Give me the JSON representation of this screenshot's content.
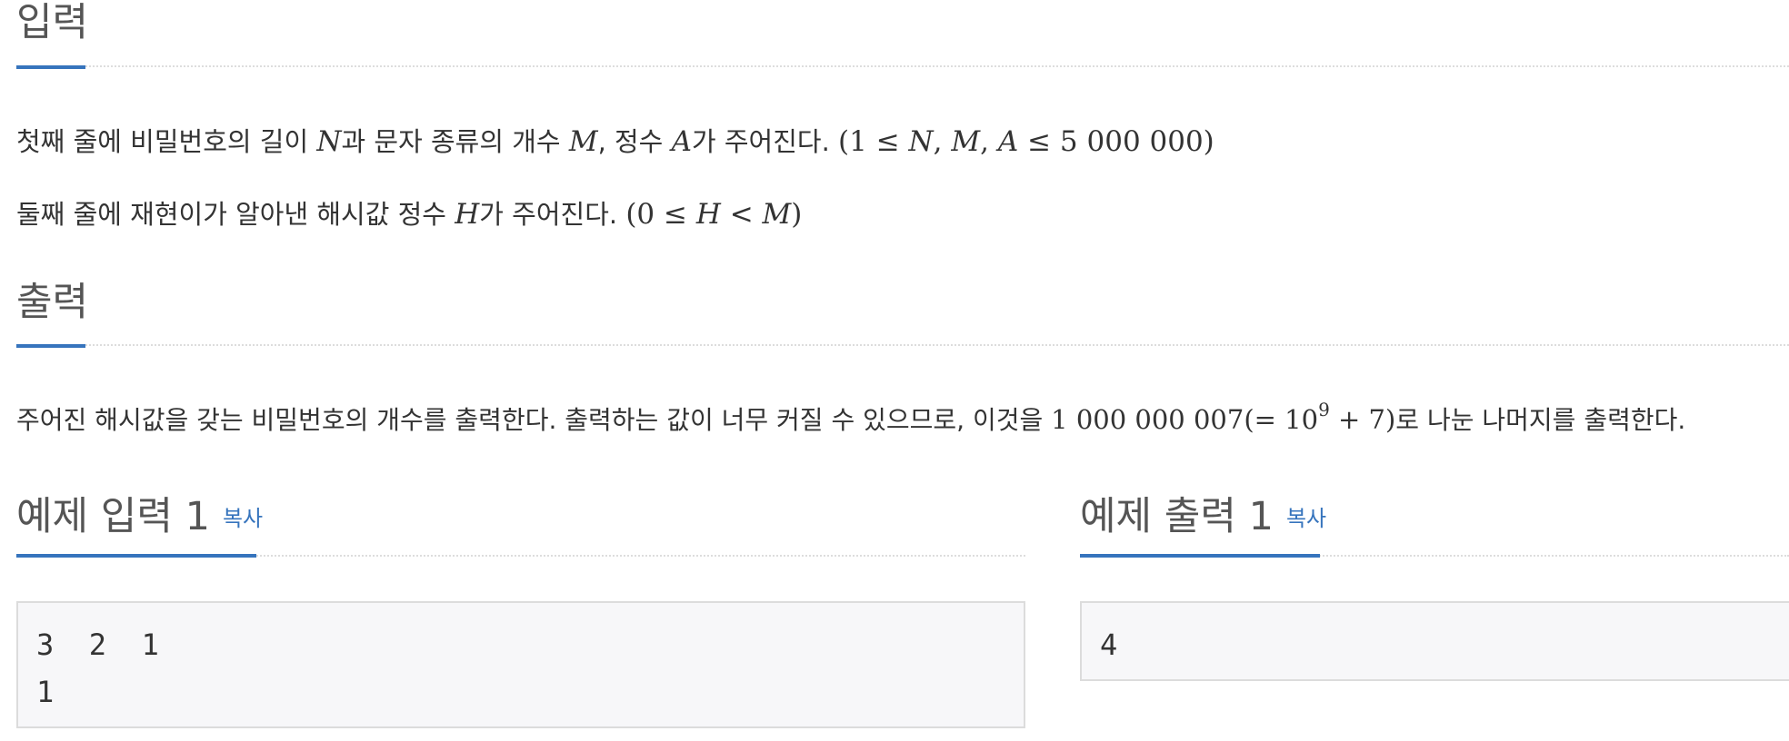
{
  "input_section": {
    "title": "입력",
    "line1": {
      "t1": "첫째 줄에 비밀번호의 길이 ",
      "N": "N",
      "t2": "과 문자 종류의 개수 ",
      "M": "M",
      "t3": ", 정수 ",
      "A": "A",
      "t4": "가 주어진다. ",
      "math_open": "(1 ≤ ",
      "mN": "N",
      "c1": ", ",
      "mM": "M",
      "c2": ", ",
      "mA": "A",
      "math_close": " ≤ 5 000 000)"
    },
    "line2": {
      "t1": "둘째 줄에 재현이가 알아낸 해시값 정수 ",
      "H": "H",
      "t2": "가 주어진다. ",
      "math_open": "(0 ≤ ",
      "mH": "H",
      "math_mid": " < ",
      "mM": "M",
      "math_close": ")"
    }
  },
  "output_section": {
    "title": "출력",
    "line1": {
      "t1": "주어진 해시값을 갖는 비밀번호의 개수를 출력한다. 출력하는 값이 너무 커질 수 있으므로, 이것을 ",
      "math_a": "1 000 000 007(= 10",
      "sup": "9",
      "math_b": " + 7)",
      "t2": "로 나눈 나머지를 출력한다."
    }
  },
  "sample_input": {
    "title": "예제 입력 1",
    "copy_label": "복사",
    "content": "3  2  1\n1"
  },
  "sample_output": {
    "title": "예제 출력 1",
    "copy_label": "복사",
    "content": "4"
  },
  "colors": {
    "accent": "#3674bd",
    "heading": "#555555",
    "text": "#333333",
    "sample_bg": "#f7f7f9",
    "sample_border": "#dcdcdc"
  }
}
